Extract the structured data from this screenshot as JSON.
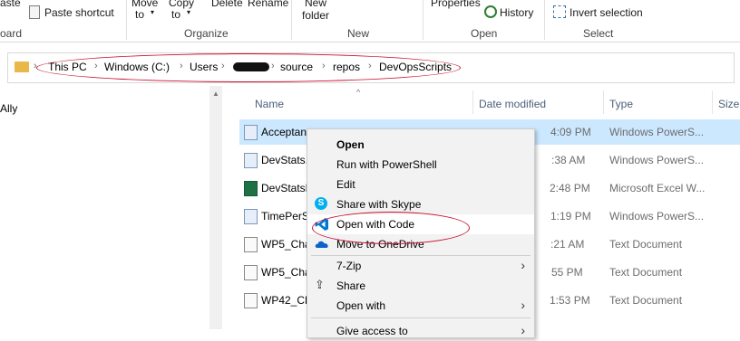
{
  "ribbon": {
    "paste_partial": "aste",
    "paste_shortcut": "Paste shortcut",
    "move_to": "Move",
    "to1": "to",
    "copy_to": "Copy",
    "to2": "to",
    "delete": "Delete",
    "rename": "Rename",
    "new_folder_1": "New",
    "new_folder_2": "folder",
    "properties": "Properties",
    "history": "History",
    "invert_selection": "Invert selection",
    "group_clipboard": "oard",
    "group_organize": "Organize",
    "group_new": "New",
    "group_open": "Open",
    "group_select": "Select"
  },
  "address": {
    "crumbs": [
      "This PC",
      "Windows (C:)",
      "Users",
      "",
      "source",
      "repos",
      "DevOpsScripts"
    ]
  },
  "nav": {
    "partial_item": "Ally"
  },
  "columns": {
    "name": "Name",
    "date": "Date modified",
    "type": "Type",
    "size": "Size"
  },
  "files": [
    {
      "name": "Acceptan",
      "date": "",
      "time": "4:09 PM",
      "type": "Windows PowerS...",
      "icon": "powershell-file-icon"
    },
    {
      "name": "DevStats.",
      "date": "",
      "time": ":38 AM",
      "type": "Windows PowerS...",
      "icon": "powershell-file-icon"
    },
    {
      "name": "DevStatsF",
      "date": "",
      "time": "2:48 PM",
      "type": "Microsoft Excel W...",
      "icon": "excel-file-icon"
    },
    {
      "name": "TimePerS",
      "date": "",
      "time": "1:19 PM",
      "type": "Windows PowerS...",
      "icon": "powershell-file-icon"
    },
    {
      "name": "WP5_Cha",
      "date": "",
      "time": ":21 AM",
      "type": "Text Document",
      "icon": "text-file-icon"
    },
    {
      "name": "WP5_Cha",
      "date": "",
      "time": "55 PM",
      "type": "Text Document",
      "icon": "text-file-icon"
    },
    {
      "name": "WP42_CH",
      "date": "",
      "time": "1:53 PM",
      "type": "Text Document",
      "icon": "text-file-icon"
    }
  ],
  "context_menu": {
    "open": "Open",
    "run_ps": "Run with PowerShell",
    "edit": "Edit",
    "share_skype": "Share with Skype",
    "open_code": "Open with Code",
    "move_onedrive": "Move to OneDrive",
    "seven_zip": "7-Zip",
    "share": "Share",
    "open_with": "Open with",
    "give_access": "Give access to"
  },
  "colors": {
    "selection": "#cce8ff",
    "annotation": "#c8102e",
    "vscode": "#0078d4"
  }
}
